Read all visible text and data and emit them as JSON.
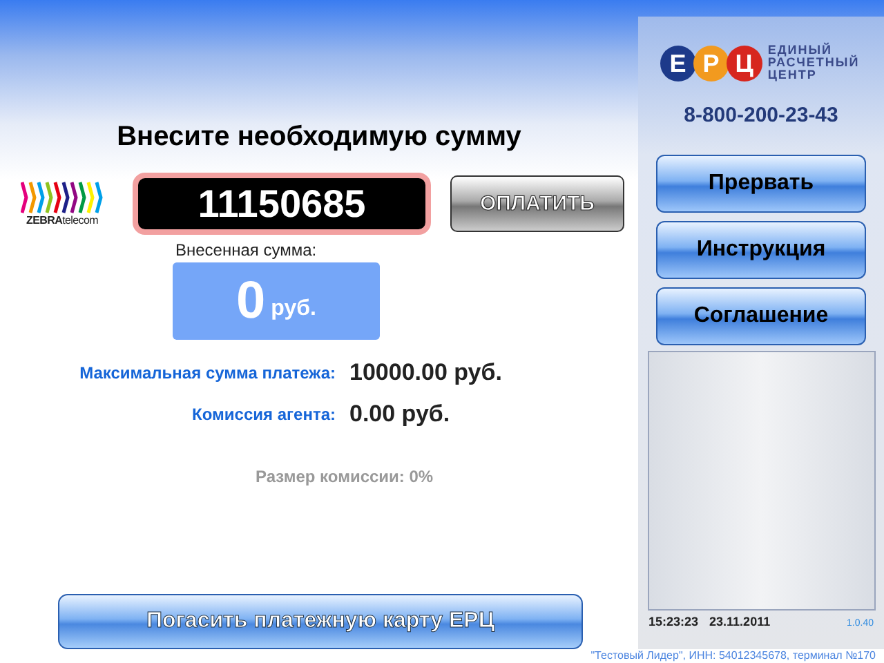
{
  "main": {
    "title": "Внесите необходимую сумму",
    "provider_logo": {
      "brand": "ZEBRA",
      "suffix": "telecom"
    },
    "account_field": {
      "value": "11150685"
    },
    "pay_button": {
      "label": "ОПЛАТИТЬ"
    },
    "deposited": {
      "label": "Внесенная сумма:",
      "amount": "0",
      "currency": "руб."
    },
    "info_rows": [
      {
        "label": "Максимальная сумма платежа:",
        "value": "10000.00 руб."
      },
      {
        "label": "Комиссия агента:",
        "value": "0.00 руб."
      }
    ],
    "commission_note": "Размер комиссии: 0%",
    "bottom_button": {
      "label": "Погасить платежную карту ЕРЦ"
    }
  },
  "sidebar": {
    "logo": {
      "letters": [
        "Е",
        "Р",
        "Ц"
      ],
      "lines": [
        "ЕДИНЫЙ",
        "РАСЧЕТНЫЙ",
        "ЦЕНТР"
      ]
    },
    "phone": "8-800-200-23-43",
    "buttons": [
      {
        "label": "Прервать"
      },
      {
        "label": "Инструкция"
      },
      {
        "label": "Соглашение"
      }
    ],
    "status_bar": {
      "time": "15:23:23",
      "date": "23.11.2011",
      "version": "1.0.40"
    }
  },
  "footer": "\"Тестовый Лидер\", ИНН: 54012345678, терминал №170"
}
